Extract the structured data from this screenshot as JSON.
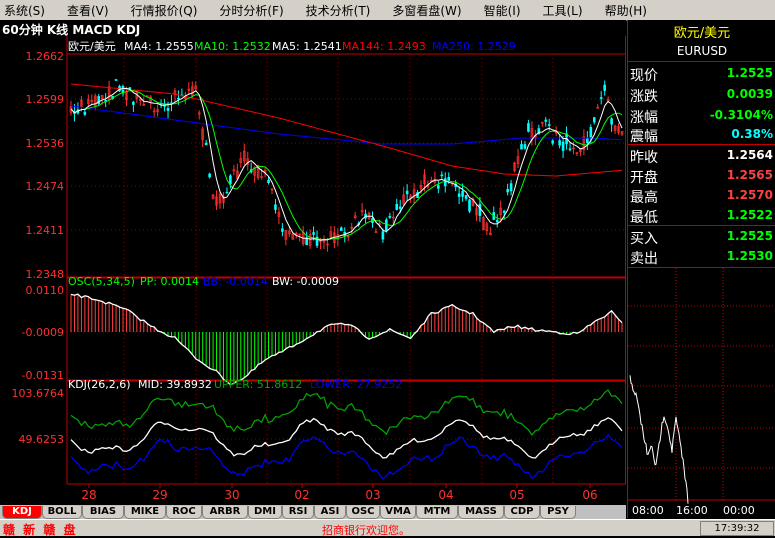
{
  "menu": [
    {
      "label": "系统(S)"
    },
    {
      "label": "查看(V)"
    },
    {
      "label": "行情报价(Q)"
    },
    {
      "label": "分时分析(F)"
    },
    {
      "label": "技术分析(T)"
    },
    {
      "label": "多窗看盘(W)"
    },
    {
      "label": "智能(I)"
    },
    {
      "label": "工具(L)"
    },
    {
      "label": "帮助(H)"
    }
  ],
  "chart_header": "60分钟 K线 MACD KDJ",
  "price_panel": {
    "title_symbol": "欧元/美元",
    "ma_labels": [
      {
        "text": "MA4: 1.2555",
        "color": "#ffffff"
      },
      {
        "text": "MA10: 1.2532",
        "color": "#00ff00"
      },
      {
        "text": "MA5: 1.2541",
        "color": "#ffffff"
      },
      {
        "text": "MA144: 1.2493",
        "color": "#ff0000"
      },
      {
        "text": "MA250: 1.2529",
        "color": "#0000ff"
      }
    ],
    "y_ticks": [
      "1.2662",
      "1.2599",
      "1.2536",
      "1.2474",
      "1.2411",
      "1.2348"
    ]
  },
  "osc_panel": {
    "labels": [
      {
        "text": "OSC(5,34,5)",
        "color": "#00ff00"
      },
      {
        "text": "PP: 0.0014",
        "color": "#00ff00"
      },
      {
        "text": "BB: -0.0014",
        "color": "#0000ff"
      },
      {
        "text": "BW: -0.0009",
        "color": "#ffffff"
      }
    ],
    "y_ticks": [
      "0.0110",
      "-0.0009",
      "-0.0131"
    ]
  },
  "kdj_panel": {
    "labels": [
      {
        "text": "KDJ(26,2,6)",
        "color": "#ffffff"
      },
      {
        "text": "MID: 39.8932",
        "color": "#ffffff"
      },
      {
        "text": "UPPER: 51.8612",
        "color": "#00aa00"
      },
      {
        "text": "LOWER: 27.9252",
        "color": "#0000ff"
      }
    ],
    "y_ticks": [
      "103.6764",
      "49.6253"
    ]
  },
  "x_axis": [
    "28",
    "29",
    "30",
    "02",
    "03",
    "04",
    "05",
    "06"
  ],
  "quote": {
    "title": "欧元/美元",
    "code": "EURUSD",
    "rows": [
      {
        "label": "现价",
        "value": "1.2525",
        "color": "#00ff00"
      },
      {
        "label": "涨跌",
        "value": "0.0039",
        "color": "#00ff00"
      },
      {
        "label": "涨幅",
        "value": "-0.3104%",
        "color": "#00ff00"
      },
      {
        "label": "震幅",
        "value": "0.38%",
        "color": "#00ffff"
      },
      {
        "label": "昨收",
        "value": "1.2564",
        "color": "#ffffff"
      },
      {
        "label": "开盘",
        "value": "1.2565",
        "color": "#ff4040"
      },
      {
        "label": "最高",
        "value": "1.2570",
        "color": "#ff4040"
      },
      {
        "label": "最低",
        "value": "1.2522",
        "color": "#00ff00"
      },
      {
        "label": "买入",
        "value": "1.2525",
        "color": "#00ff00"
      },
      {
        "label": "卖出",
        "value": "1.2530",
        "color": "#00ff00"
      }
    ]
  },
  "mini_chart": {
    "time_labels": [
      "08:00",
      "16:00",
      "00:00"
    ]
  },
  "tabs": [
    "KDJ",
    "BOLL",
    "BIAS",
    "MIKE",
    "ROC",
    "ARBR",
    "DMI",
    "RSI",
    "ASI",
    "OSC",
    "VMA",
    "MTM",
    "MASS",
    "CDP",
    "PSY"
  ],
  "active_tab": "KDJ",
  "status": {
    "brand": "赣 新 赣 盘",
    "message": "招商银行欢迎您。",
    "time": "17:39:32"
  },
  "colors": {
    "axis_red": "#c00000",
    "grid": "#8b0000",
    "candle_up": "#ff3030",
    "candle_down": "#00ffff",
    "ma4": "#ffffff",
    "ma10": "#00ff00",
    "ma144": "#ff0000",
    "ma250": "#0000ff"
  }
}
